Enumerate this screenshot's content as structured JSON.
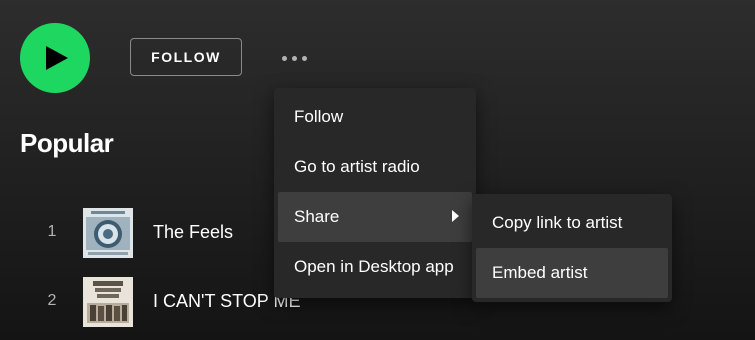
{
  "header": {
    "follow_label": "FOLLOW",
    "more_icon": "more-horizontal-icon",
    "play_icon": "play-icon"
  },
  "popular": {
    "heading": "Popular",
    "tracks": [
      {
        "number": "1",
        "title": "The Feels"
      },
      {
        "number": "2",
        "title": "I CAN'T STOP ME"
      }
    ]
  },
  "context_menu": {
    "items": [
      {
        "label": "Follow"
      },
      {
        "label": "Go to artist radio"
      },
      {
        "label": "Share"
      },
      {
        "label": "Open in Desktop app"
      }
    ],
    "share_submenu": [
      {
        "label": "Copy link to artist"
      },
      {
        "label": "Embed artist"
      }
    ]
  },
  "colors": {
    "accent": "#1ed760",
    "menu_bg": "#282828",
    "menu_hover": "#3e3e3e"
  }
}
